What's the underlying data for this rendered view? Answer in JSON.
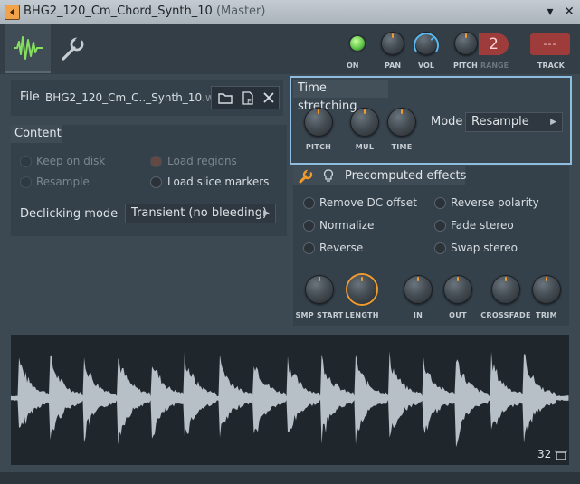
{
  "window": {
    "title": "BHG2_120_Cm_Chord_Synth_10",
    "subtitle": "(Master)",
    "pin_label": "▾",
    "close_label": "✕"
  },
  "header": {
    "on_label": "ON",
    "pan_label": "PAN",
    "vol_label": "VOL",
    "pitch_label": "PITCH",
    "range_label": "RANGE",
    "range_value": "2",
    "track_label": "TRACK",
    "track_value": "---"
  },
  "file": {
    "label": "File",
    "name": "BHG2_120_Cm_C.._Synth_10",
    "ext": ".wav"
  },
  "content": {
    "title": "Content",
    "keep_on_disk": "Keep on disk",
    "load_regions": "Load regions",
    "resample": "Resample",
    "load_slice_markers": "Load slice markers",
    "declicking_label": "Declicking mode",
    "declicking_value": "Transient (no bleeding)"
  },
  "time_stretching": {
    "title": "Time stretching",
    "pitch_label": "PITCH",
    "mul_label": "MUL",
    "time_label": "TIME",
    "mode_label": "Mode",
    "mode_value": "Resample"
  },
  "precomputed": {
    "title": "Precomputed effects",
    "remove_dc": "Remove DC offset",
    "reverse_polarity": "Reverse polarity",
    "normalize": "Normalize",
    "fade_stereo": "Fade stereo",
    "reverse": "Reverse",
    "swap_stereo": "Swap stereo",
    "knobs": [
      "SMP START",
      "LENGTH",
      "IN",
      "OUT",
      "CROSSFADE",
      "TRIM"
    ]
  },
  "waveform": {
    "zoom_value": "32"
  },
  "colors": {
    "accent_orange": "#f29b2d",
    "accent_blue": "#5ab8f0",
    "led_green": "#7de065",
    "highlight_box": "#8fbde0"
  }
}
